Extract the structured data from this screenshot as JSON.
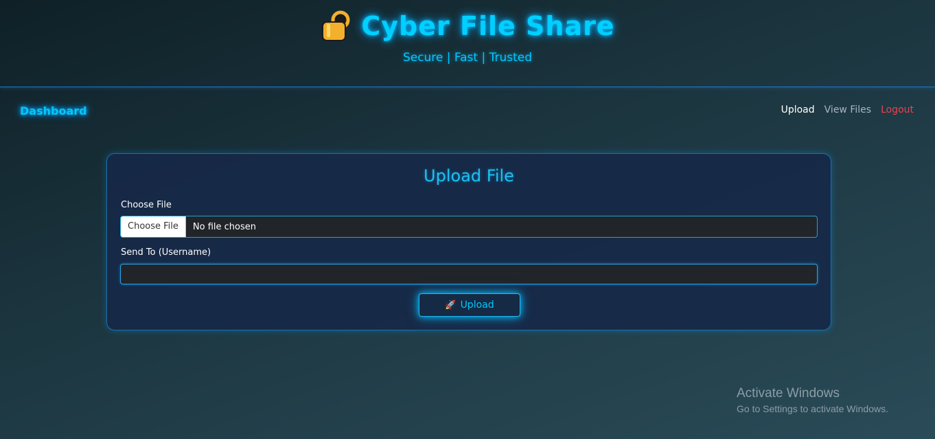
{
  "header": {
    "lock_icon": "lock-icon",
    "title": "Cyber File Share",
    "tagline": "Secure | Fast | Trusted"
  },
  "nav": {
    "brand": "Dashboard",
    "links": [
      "Upload",
      "View Files",
      "Logout"
    ]
  },
  "upload_card": {
    "title": "Upload File",
    "file_label": "Choose File",
    "file_button": "Choose File",
    "file_status": "No file chosen",
    "username_label": "Send To (Username)",
    "username_value": "",
    "button_icon": "rocket-icon",
    "button_label": "Upload"
  },
  "watermark": {
    "title": "Activate Windows",
    "subtitle": "Go to Settings to activate Windows."
  },
  "colors": {
    "accent": "#00c8ff",
    "logout": "#e8434f",
    "card": "#162848",
    "input": "#212529"
  }
}
